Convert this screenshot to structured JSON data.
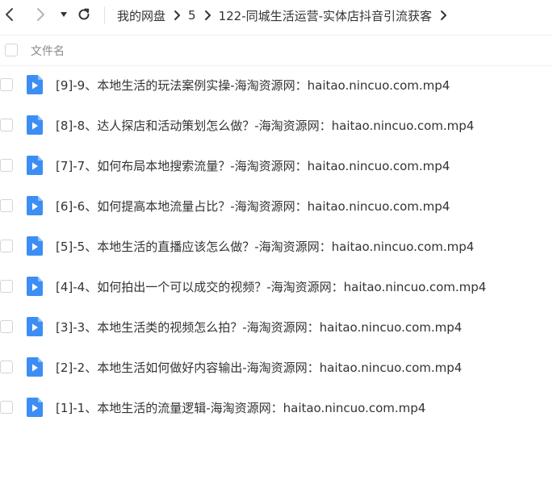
{
  "toolbar": {
    "back_icon": "chevron-left-icon",
    "forward_icon": "chevron-right-icon",
    "dropdown_icon": "caret-down-icon",
    "refresh_icon": "refresh-icon"
  },
  "breadcrumb": {
    "items": [
      "我的网盘",
      "5",
      "122-同城生活运营-实体店抖音引流获客"
    ],
    "separator_icon": "chevron-right-icon"
  },
  "list_header": {
    "column_name": "文件名"
  },
  "files": [
    {
      "name": "[9]-9、本地生活的玩法案例实操-海淘资源网：haitao.nincuo.com.mp4",
      "icon": "video-file-icon"
    },
    {
      "name": "[8]-8、达人探店和活动策划怎么做？-海淘资源网：haitao.nincuo.com.mp4",
      "icon": "video-file-icon"
    },
    {
      "name": "[7]-7、如何布局本地搜索流量？-海淘资源网：haitao.nincuo.com.mp4",
      "icon": "video-file-icon"
    },
    {
      "name": "[6]-6、如何提高本地流量占比？-海淘资源网：haitao.nincuo.com.mp4",
      "icon": "video-file-icon"
    },
    {
      "name": "[5]-5、本地生活的直播应该怎么做？-海淘资源网：haitao.nincuo.com.mp4",
      "icon": "video-file-icon"
    },
    {
      "name": "[4]-4、如何拍出一个可以成交的视频？-海淘资源网：haitao.nincuo.com.mp4",
      "icon": "video-file-icon"
    },
    {
      "name": "[3]-3、本地生活类的视频怎么拍？-海淘资源网：haitao.nincuo.com.mp4",
      "icon": "video-file-icon"
    },
    {
      "name": "[2]-2、本地生活如何做好内容输出-海淘资源网：haitao.nincuo.com.mp4",
      "icon": "video-file-icon"
    },
    {
      "name": "[1]-1、本地生活的流量逻辑-海淘资源网：haitao.nincuo.com.mp4",
      "icon": "video-file-icon"
    }
  ],
  "colors": {
    "accent": "#3d8ef4",
    "text": "#333333",
    "muted": "#8a8a8a"
  }
}
